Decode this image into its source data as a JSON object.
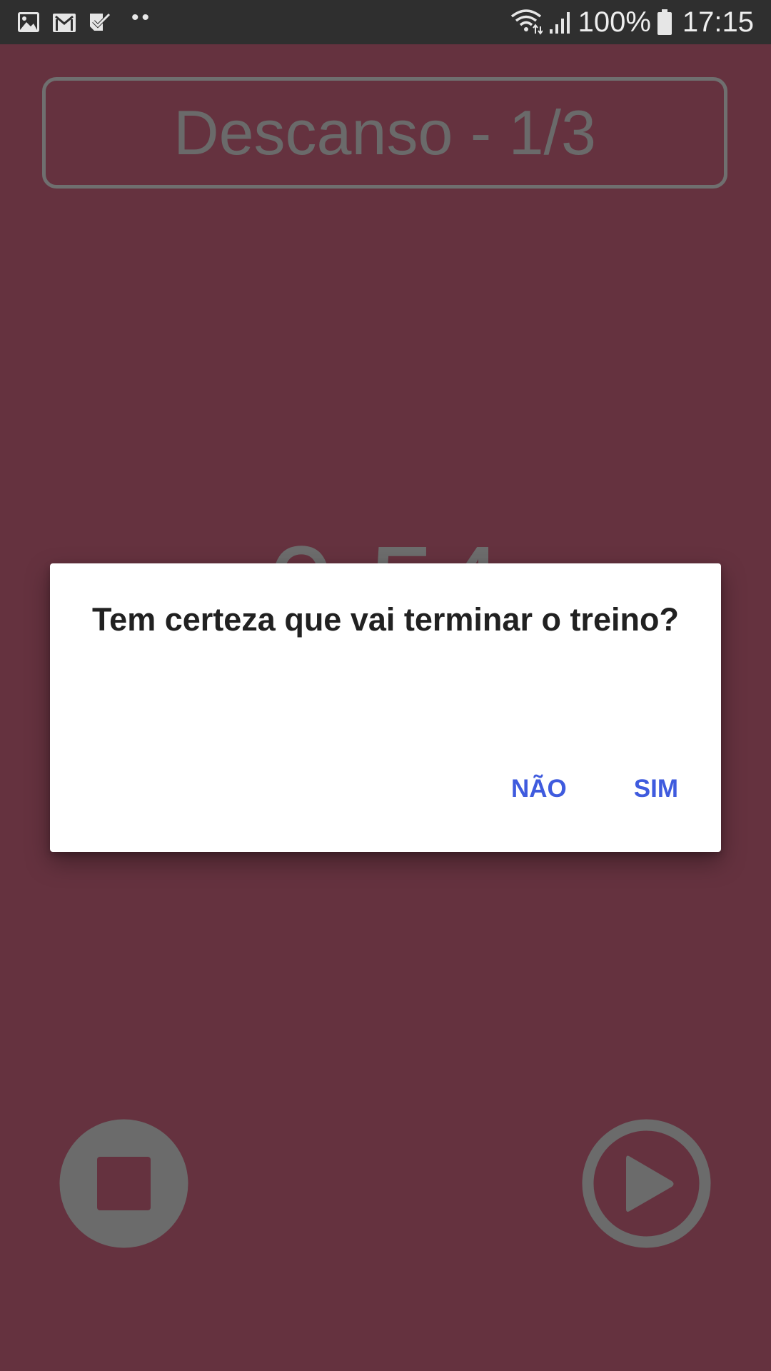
{
  "status_bar": {
    "left_icons": [
      "gallery-icon",
      "gmail-icon",
      "task-check-icon",
      "more-notifications-icon"
    ],
    "right_icons": [
      "wifi-icon",
      "signal-icon",
      "battery-icon"
    ],
    "battery": "100%",
    "time": "17:15"
  },
  "header": {
    "title": "Descanso - 1/3"
  },
  "timer": {
    "value": "0:54"
  },
  "controls": {
    "stop_icon": "stop-icon",
    "play_icon": "play-icon"
  },
  "dialog": {
    "title": "Tem certeza que vai terminar o treino?",
    "negative_label": "NÃO",
    "positive_label": "SIM"
  },
  "colors": {
    "background": "#65323f",
    "status_bar": "#2f2f2f",
    "muted_gray": "#6a6a6a",
    "dialog_button": "#3f5bde"
  }
}
